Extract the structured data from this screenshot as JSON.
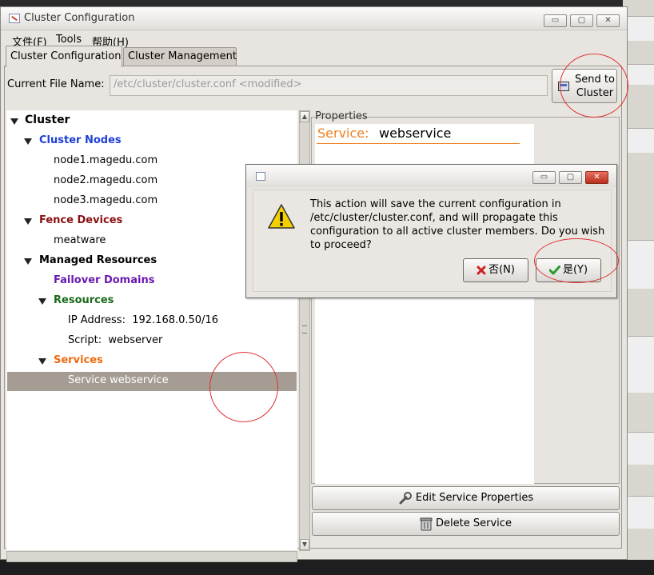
{
  "window": {
    "title": "Cluster Configuration",
    "controls": {
      "minimize": "▭",
      "maximize": "▢",
      "close": "✕"
    }
  },
  "menubar": {
    "items": [
      "文件(F)",
      "Tools",
      "帮助(H)"
    ]
  },
  "tabs": [
    {
      "label": "Cluster Configuration",
      "active": true
    },
    {
      "label": "Cluster Management",
      "active": false
    }
  ],
  "file": {
    "label": "Current File Name:",
    "value": "/etc/cluster/cluster.conf <modified>"
  },
  "send_button": {
    "line1": "Send to",
    "line2": "Cluster"
  },
  "tree": {
    "root": "Cluster",
    "cluster_nodes": {
      "label": "Cluster Nodes",
      "children": [
        "node1.magedu.com",
        "node2.magedu.com",
        "node3.magedu.com"
      ]
    },
    "fence_devices": {
      "label": "Fence Devices",
      "children": [
        "meatware"
      ]
    },
    "managed_resources": {
      "label": "Managed Resources"
    },
    "failover_domains": {
      "label": "Failover Domains"
    },
    "resources": {
      "label": "Resources",
      "children": [
        "IP Address:  192.168.0.50/16",
        "Script:  webserver"
      ]
    },
    "services": {
      "label": "Services",
      "children": [
        "Service webservice"
      ]
    }
  },
  "properties": {
    "title": "Properties",
    "service_label": "Service:",
    "service_value": "webservice"
  },
  "buttons": {
    "edit_service": "Edit Service Properties",
    "delete_service": "Delete Service"
  },
  "dialog": {
    "message": "This action will save the current configuration in /etc/cluster/cluster.conf, and will propagate this configuration to all active cluster members. Do you wish to proceed?",
    "no_label": "否(N)",
    "yes_label": "是(Y)"
  },
  "colors": {
    "cluster_nodes": "#1d3fd6",
    "fence_devices": "#8a1010",
    "failover_domains": "#6a1ab0",
    "resources": "#1a6a1a",
    "services": "#ee6a10",
    "service_label": "#f08020",
    "annotation": "#e03030"
  }
}
